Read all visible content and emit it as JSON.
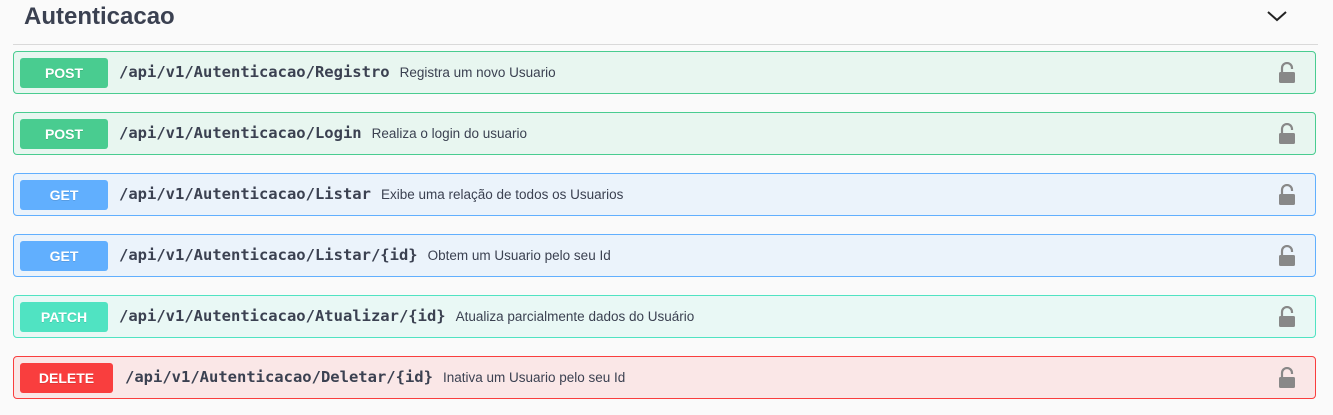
{
  "section": {
    "title": "Autenticacao"
  },
  "operations": [
    {
      "method": "POST",
      "path": "/api/v1/Autenticacao/Registro",
      "description": "Registra um novo Usuario"
    },
    {
      "method": "POST",
      "path": "/api/v1/Autenticacao/Login",
      "description": "Realiza o login do usuario"
    },
    {
      "method": "GET",
      "path": "/api/v1/Autenticacao/Listar",
      "description": "Exibe uma relação de todos os Usuarios"
    },
    {
      "method": "GET",
      "path": "/api/v1/Autenticacao/Listar/{id}",
      "description": "Obtem um Usuario pelo seu Id"
    },
    {
      "method": "PATCH",
      "path": "/api/v1/Autenticacao/Atualizar/{id}",
      "description": "Atualiza parcialmente dados do Usuário"
    },
    {
      "method": "DELETE",
      "path": "/api/v1/Autenticacao/Deletar/{id}",
      "description": "Inativa um Usuario pelo seu Id"
    }
  ],
  "icons": {
    "collapse": "chevron-down-icon",
    "lock": "lock-icon"
  },
  "colors": {
    "post": "#49cc90",
    "get": "#61affe",
    "patch": "#50e3c2",
    "delete": "#f93e3e",
    "text": "#3b4151"
  }
}
